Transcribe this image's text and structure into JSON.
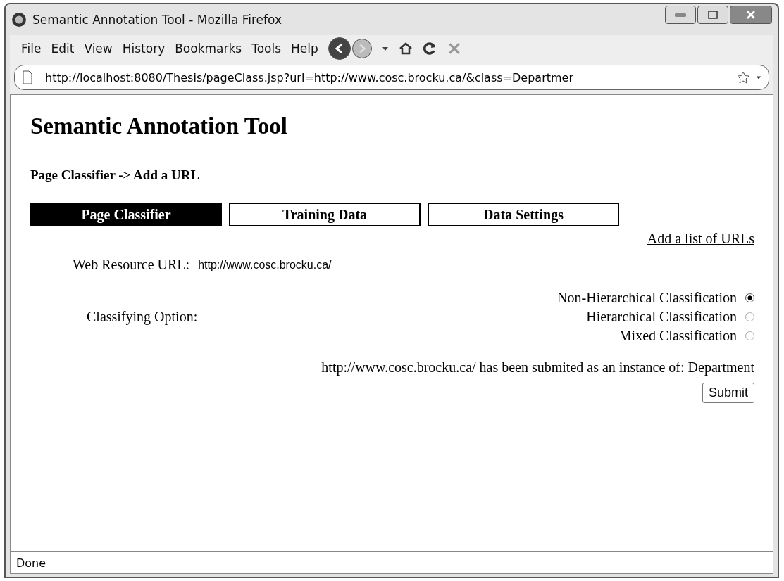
{
  "window": {
    "title": "Semantic Annotation Tool - Mozilla Firefox"
  },
  "menu": [
    "File",
    "Edit",
    "View",
    "History",
    "Bookmarks",
    "Tools",
    "Help"
  ],
  "address_bar": {
    "value": "http://localhost:8080/Thesis/pageClass.jsp?url=http://www.cosc.brocku.ca/&class=Departmer"
  },
  "page": {
    "heading": "Semantic Annotation Tool",
    "breadcrumb": "Page Classifier -> Add a URL",
    "tabs": [
      {
        "label": "Page Classifier",
        "selected": true
      },
      {
        "label": "Training Data",
        "selected": false
      },
      {
        "label": "Data Settings",
        "selected": false
      }
    ],
    "link": "Add a list of URLs",
    "url_field": {
      "label": "Web Resource URL:",
      "value": "http://www.cosc.brocku.ca/"
    },
    "option_label": "Classifying Option:",
    "options": [
      {
        "label": "Non-Hierarchical Classification",
        "selected": true
      },
      {
        "label": "Hierarchical Classification",
        "selected": false
      },
      {
        "label": "Mixed Classification",
        "selected": false
      }
    ],
    "message": "http://www.cosc.brocku.ca/ has been submited as an instance of: Department",
    "submit": "Submit"
  },
  "status_bar": {
    "text": "Done"
  }
}
